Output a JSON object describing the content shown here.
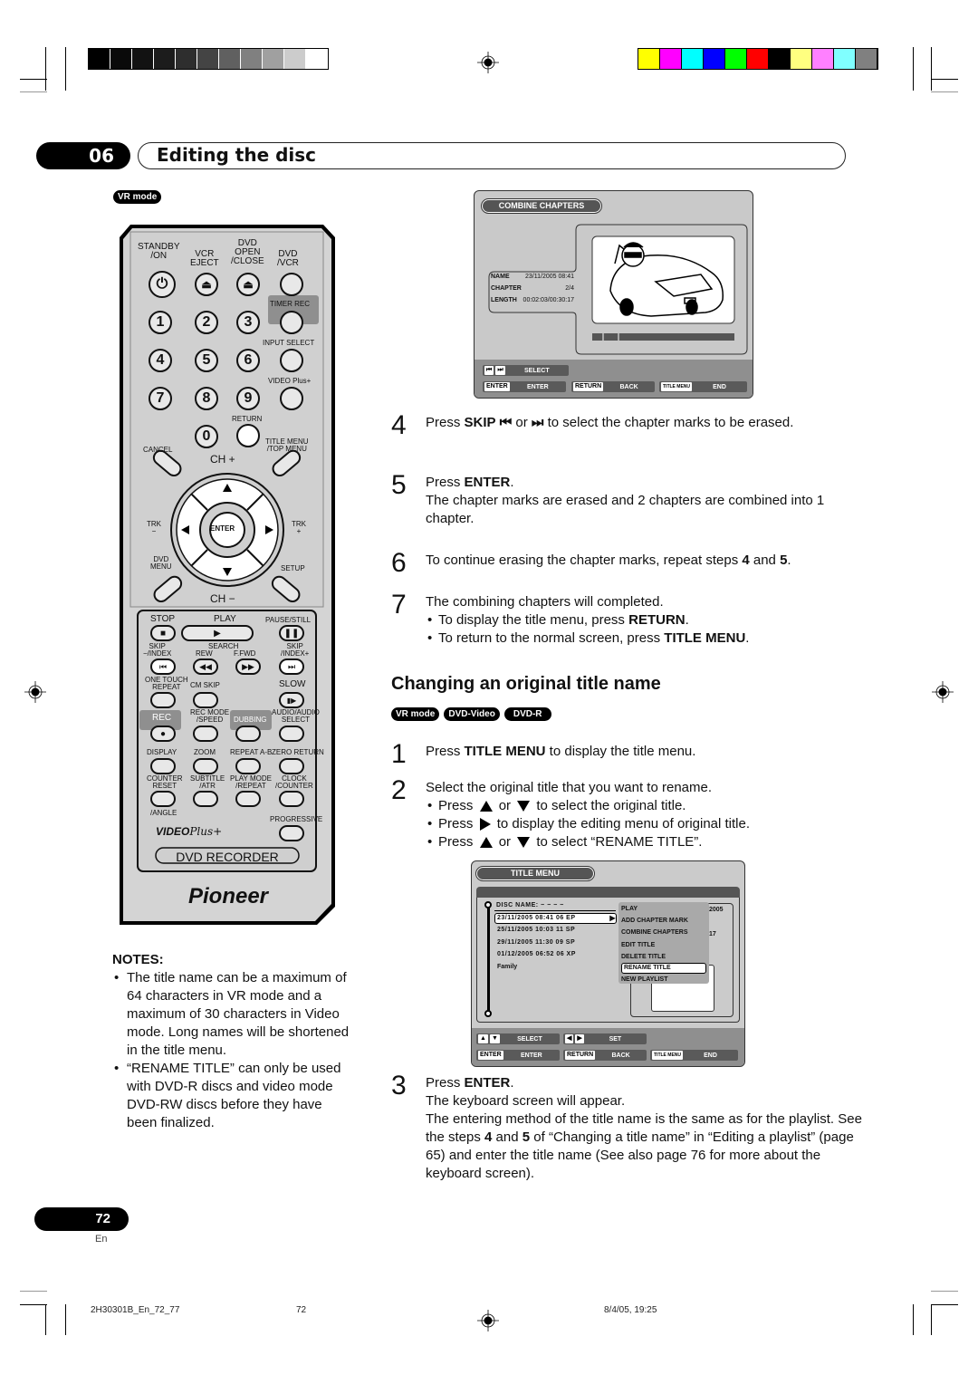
{
  "print_marks": {
    "grayscale_swatches": [
      "#000000",
      "#0a0a0a",
      "#121212",
      "#1c1c1c",
      "#2e2e2e",
      "#444444",
      "#606060",
      "#808080",
      "#a0a0a0",
      "#cccccc",
      "#ffffff"
    ],
    "color_swatches": [
      "#ffff00",
      "#ff00ff",
      "#00ffff",
      "#0000ff",
      "#00ff00",
      "#ff0000",
      "#000000",
      "#ffff80",
      "#ff80ff",
      "#80ffff",
      "#808080"
    ]
  },
  "header": {
    "chapter_number": "06",
    "chapter_title": "Editing the disc"
  },
  "remote_section": {
    "mode_badge": "VR mode",
    "remote": {
      "top_labels": {
        "standby": "STANDBY\n/ON",
        "vcr_eject": "VCR\nEJECT",
        "dvd_open": "DVD\nOPEN\n/CLOSE",
        "dvd_vcr": "DVD\n/VCR"
      },
      "digits": [
        "1",
        "2",
        "3",
        "4",
        "5",
        "6",
        "7",
        "8",
        "9",
        "0"
      ],
      "side_labels": {
        "timer_rec": "TIMER REC",
        "input_select": "INPUT SELECT",
        "video_plus": "VIDEO Plus+",
        "return": "RETURN"
      },
      "nav": {
        "cancel": "CANCEL",
        "title_menu": "TITLE MENU\n/TOP MENU",
        "ch_plus": "CH +",
        "ch_minus": "CH −",
        "trk_minus": "TRK\n−",
        "trk_plus": "TRK\n+",
        "dvd_menu": "DVD\nMENU",
        "setup": "SETUP",
        "enter": "ENTER"
      },
      "transport": {
        "stop": "STOP",
        "play": "PLAY",
        "pause": "PAUSE/STILL",
        "skip_minus": "SKIP\n−/INDEX",
        "search": "SEARCH",
        "rew": "REW",
        "ffwd": "F.FWD",
        "skip_plus": "SKIP\n/INDEX+"
      },
      "row_a": {
        "one_touch": "ONE TOUCH\nREPEAT",
        "cm_skip": "CM SKIP",
        "slow": "SLOW"
      },
      "row_b": {
        "rec": "REC",
        "rec_mode": "REC MODE\n/SPEED",
        "dubbing": "DUBBING",
        "audio": "AUDIO/AUDIO\nSELECT"
      },
      "row_c": {
        "display": "DISPLAY",
        "zoom": "ZOOM",
        "repeat_ab": "REPEAT A-B",
        "zero_return": "ZERO RETURN"
      },
      "row_d": {
        "counter_reset": "COUNTER\nRESET",
        "subtitle": "SUBTITLE\n/ATR",
        "play_mode": "PLAY MODE\n/REPEAT",
        "clock": "CLOCK\n/COUNTER"
      },
      "angle": "/ANGLE",
      "progressive": "PROGRESSIVE",
      "videoplus_logo": "VIDEO",
      "videoplus_script": "Plus+",
      "product_label": "DVD RECORDER",
      "brand": "Pioneer"
    }
  },
  "combine_screen": {
    "title": "COMBINE CHAPTERS",
    "info": [
      {
        "label": "NAME",
        "value": "23/11/2005 08:41"
      },
      {
        "label": "CHAPTER",
        "value": "2/4"
      },
      {
        "label": "LENGTH",
        "value": "00:02:03/00:30:17"
      }
    ],
    "keys_row1": [
      {
        "key": "⏮ ⏭",
        "label": "SELECT"
      }
    ],
    "keys_row2": [
      {
        "key": "ENTER",
        "label": "ENTER"
      },
      {
        "key": "RETURN",
        "label": "BACK"
      },
      {
        "key": "TITLE MENU",
        "label": "END"
      }
    ]
  },
  "steps_combine": [
    {
      "num": "4",
      "html_parts": [
        "Press ",
        "SKIP",
        " ⏮ or ⏭ to select the chapter marks to be erased."
      ]
    },
    {
      "num": "5",
      "line1_pre": "Press ",
      "line1_bold": "ENTER",
      "line1_post": ".",
      "line2": "The chapter marks are erased and 2 chapters are combined into 1 chapter."
    },
    {
      "num": "6",
      "pre": "To continue erasing the chapter marks, repeat steps ",
      "b1": "4",
      "mid": " and ",
      "b2": "5",
      "post": "."
    },
    {
      "num": "7",
      "text": "The combining chapters will completed.",
      "bullets": [
        {
          "pre": "To display the title menu, press ",
          "bold": "RETURN",
          "post": "."
        },
        {
          "pre": "To return to the normal screen, press ",
          "bold": "TITLE MENU",
          "post": "."
        }
      ]
    }
  ],
  "step4": {
    "num": "4",
    "pre": "Press ",
    "bold": "SKIP",
    "or": "or",
    "post": "to select the chapter marks to be erased."
  },
  "step5": {
    "num": "5",
    "pre": "Press ",
    "bold": "ENTER",
    "post": ".",
    "body": "The chapter marks are erased and 2 chapters are combined into 1 chapter."
  },
  "step6": {
    "num": "6",
    "pre": "To continue erasing the chapter marks, repeat steps ",
    "b1": "4",
    "mid": " and ",
    "b2": "5",
    "post": "."
  },
  "step7": {
    "num": "7",
    "text": "The combining chapters will completed.",
    "b1_pre": "To display the title menu, press ",
    "b1_bold": "RETURN",
    "b1_post": ".",
    "b2_pre": "To return to the normal screen, press ",
    "b2_bold": "TITLE MENU",
    "b2_post": "."
  },
  "rename_section": {
    "title": "Changing an original title name",
    "badges": [
      "VR mode",
      "DVD-Video",
      "DVD-R"
    ],
    "step1": {
      "num": "1",
      "pre": "Press ",
      "bold": "TITLE MENU",
      "post": " to display the title menu."
    },
    "step2": {
      "num": "2",
      "text": "Select the original title that you want to rename.",
      "b1_pre": "Press",
      "b1_or": "or",
      "b1_post": "to select the original title.",
      "b2_pre": "Press",
      "b2_post": "to display the editing menu of original title.",
      "b3_pre": "Press",
      "b3_or": "or",
      "b3_post": "to select “RENAME TITLE”."
    },
    "step3": {
      "num": "3",
      "pre": "Press ",
      "bold": "ENTER",
      "post": ".",
      "l2": "The keyboard screen will appear.",
      "l3_a": "The entering method of the title name is the same as for the playlist. See the steps ",
      "l3_b1": "4",
      "l3_mid": " and ",
      "l3_b2": "5",
      "l3_c": " of “Changing a title name” in “Editing a playlist” (page 65) and enter the title name (See also page 76 for more about the keyboard screen)."
    }
  },
  "title_menu_screen": {
    "title": "TITLE MENU",
    "disc_name": "DISC NAME: − − − −",
    "titles": [
      "23/11/2005 08:41 06 EP",
      "25/11/2005 10:03 11 SP",
      "29/11/2005 11:30 09 SP",
      "01/12/2005 06:52 06 XP",
      "Family"
    ],
    "selected_title_index": 0,
    "context_menu": [
      "PLAY",
      "ADD CHAPTER MARK",
      "COMBINE CHAPTERS",
      "EDIT TITLE",
      "DELETE TITLE",
      "RENAME TITLE",
      "NEW PLAYLIST"
    ],
    "selected_menu_index": 5,
    "partial_info": [
      "2005",
      "17"
    ],
    "keys_row1": [
      {
        "key": "▲ ▼",
        "label": "SELECT"
      },
      {
        "key": "◀ ▶",
        "label": "SET"
      }
    ],
    "keys_row2": [
      {
        "key": "ENTER",
        "label": "ENTER"
      },
      {
        "key": "RETURN",
        "label": "BACK"
      },
      {
        "key": "TITLE MENU",
        "label": "END"
      }
    ]
  },
  "notes": {
    "heading": "NOTES:",
    "items": [
      "The title name can be a maximum of 64 characters in VR mode and a maximum of 30 characters in Video mode. Long names will be shortened in the title menu.",
      "“RENAME TITLE” can only be used with DVD-R discs and video mode DVD-RW discs before they have been finalized."
    ]
  },
  "page": {
    "number": "72",
    "language": "En"
  },
  "footer": {
    "file": "2H30301B_En_72_77",
    "page": "72",
    "timestamp": "8/4/05, 19:25"
  }
}
